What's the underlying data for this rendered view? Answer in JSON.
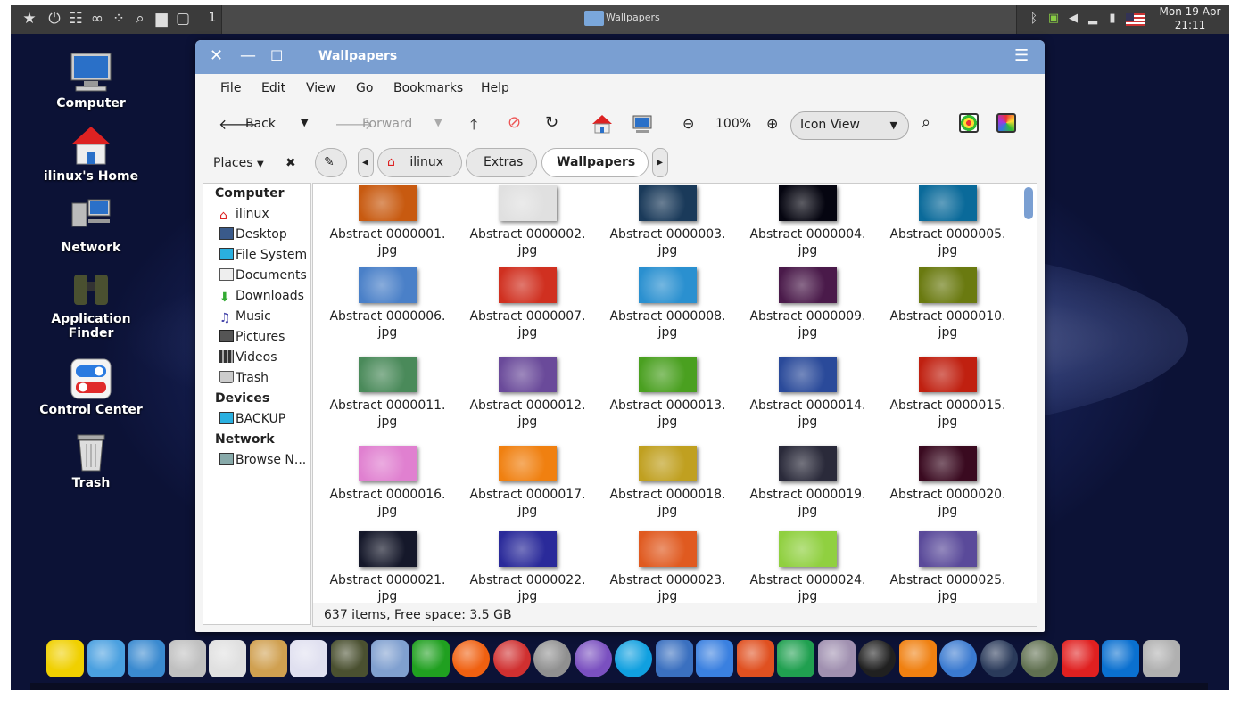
{
  "top_panel": {
    "workspace": "1",
    "task_title": "Wallpapers",
    "clock_date": "Mon 19 Apr",
    "clock_time": "21:11"
  },
  "desktop_icons": [
    {
      "label": "Computer"
    },
    {
      "label": "ilinux's Home"
    },
    {
      "label": "Network"
    },
    {
      "label": "Application Finder"
    },
    {
      "label": "Control Center"
    },
    {
      "label": "Trash"
    }
  ],
  "window": {
    "title": "Wallpapers",
    "menu": [
      "File",
      "Edit",
      "View",
      "Go",
      "Bookmarks",
      "Help"
    ],
    "toolbar": {
      "back": "Back",
      "forward": "Forward",
      "zoom": "100%",
      "view_mode": "Icon View"
    },
    "places_label": "Places",
    "path": [
      "ilinux",
      "Extras",
      "Wallpapers"
    ],
    "sidebar": {
      "computer_header": "Computer",
      "computer_items": [
        "ilinux",
        "Desktop",
        "File System",
        "Documents",
        "Downloads",
        "Music",
        "Pictures",
        "Videos",
        "Trash"
      ],
      "devices_header": "Devices",
      "devices_items": [
        "BACKUP"
      ],
      "network_header": "Network",
      "network_items": [
        "Browse N..."
      ]
    },
    "files": [
      {
        "name": "Abstract 0000001.",
        "ext": "jpg",
        "color": "#c85a10"
      },
      {
        "name": "Abstract 0000002.",
        "ext": "jpg",
        "color": "#e0e0e0"
      },
      {
        "name": "Abstract 0000003.",
        "ext": "jpg",
        "color": "#1a3a5a"
      },
      {
        "name": "Abstract 0000004.",
        "ext": "jpg",
        "color": "#050510"
      },
      {
        "name": "Abstract 0000005.",
        "ext": "jpg",
        "color": "#0a6a9a"
      },
      {
        "name": "Abstract 0000006.",
        "ext": "jpg",
        "color": "#4a80c8"
      },
      {
        "name": "Abstract 0000007.",
        "ext": "jpg",
        "color": "#d03020"
      },
      {
        "name": "Abstract 0000008.",
        "ext": "jpg",
        "color": "#2a90d0"
      },
      {
        "name": "Abstract 0000009.",
        "ext": "jpg",
        "color": "#4a1a4a"
      },
      {
        "name": "Abstract 0000010.",
        "ext": "jpg",
        "color": "#6a7a10"
      },
      {
        "name": "Abstract 0000011.",
        "ext": "jpg",
        "color": "#4a8a5a"
      },
      {
        "name": "Abstract 0000012.",
        "ext": "jpg",
        "color": "#6a4a9a"
      },
      {
        "name": "Abstract 0000013.",
        "ext": "jpg",
        "color": "#4aa020"
      },
      {
        "name": "Abstract 0000014.",
        "ext": "jpg",
        "color": "#2a4a9a"
      },
      {
        "name": "Abstract 0000015.",
        "ext": "jpg",
        "color": "#c02010"
      },
      {
        "name": "Abstract 0000016.",
        "ext": "jpg",
        "color": "#e080d0"
      },
      {
        "name": "Abstract 0000017.",
        "ext": "jpg",
        "color": "#f08010"
      },
      {
        "name": "Abstract 0000018.",
        "ext": "jpg",
        "color": "#c0a020"
      },
      {
        "name": "Abstract 0000019.",
        "ext": "jpg",
        "color": "#2a2a3a"
      },
      {
        "name": "Abstract 0000020.",
        "ext": "jpg",
        "color": "#3a0a20"
      },
      {
        "name": "Abstract 0000021.",
        "ext": "jpg",
        "color": "#15182a"
      },
      {
        "name": "Abstract 0000022.",
        "ext": "jpg",
        "color": "#2a2a9a"
      },
      {
        "name": "Abstract 0000023.",
        "ext": "jpg",
        "color": "#e05a20"
      },
      {
        "name": "Abstract 0000024.",
        "ext": "jpg",
        "color": "#90d040"
      },
      {
        "name": "Abstract 0000025.",
        "ext": "jpg",
        "color": "#5a4a9a"
      }
    ],
    "status": "637 items, Free space: 3.5 GB"
  },
  "dock_items": [
    {
      "name": "favorites-icon",
      "color": "#f0d000"
    },
    {
      "name": "apps-grid-icon",
      "color": "#4aa0e0"
    },
    {
      "name": "desktop-icon",
      "color": "#3a8ad0"
    },
    {
      "name": "file-cabinet-icon",
      "color": "#c0c0c0"
    },
    {
      "name": "control-center-icon",
      "color": "#e0e0e0"
    },
    {
      "name": "color-palette-icon",
      "color": "#d0a050"
    },
    {
      "name": "software-store-icon",
      "color": "#e0e0f0"
    },
    {
      "name": "binoculars-icon",
      "color": "#4a5030"
    },
    {
      "name": "rocket-icon",
      "color": "#80a0d0"
    },
    {
      "name": "pipe-icon",
      "color": "#20a020"
    },
    {
      "name": "firefox-icon",
      "color": "#f06010"
    },
    {
      "name": "chrome-icon",
      "color": "#d03030"
    },
    {
      "name": "google-earth-icon",
      "color": "#909090"
    },
    {
      "name": "viber-icon",
      "color": "#7a50c0"
    },
    {
      "name": "skype-icon",
      "color": "#10a0e0"
    },
    {
      "name": "mail-icon",
      "color": "#3a70c0"
    },
    {
      "name": "wps-writer-icon",
      "color": "#3a80e0"
    },
    {
      "name": "wps-presentation-icon",
      "color": "#e05020"
    },
    {
      "name": "wps-spreadsheet-icon",
      "color": "#20a050"
    },
    {
      "name": "webcam-icon",
      "color": "#a090b0"
    },
    {
      "name": "anydesk-a-icon",
      "color": "#202020"
    },
    {
      "name": "vlc-icon",
      "color": "#f08010"
    },
    {
      "name": "qbittorrent-icon",
      "color": "#3a7ad0"
    },
    {
      "name": "steam-icon",
      "color": "#2a3a5a"
    },
    {
      "name": "timeshift-icon",
      "color": "#607050"
    },
    {
      "name": "anydesk-icon",
      "color": "#e02020"
    },
    {
      "name": "teamviewer-icon",
      "color": "#0a70d0"
    },
    {
      "name": "trash-icon",
      "color": "#b0b0b0"
    }
  ]
}
